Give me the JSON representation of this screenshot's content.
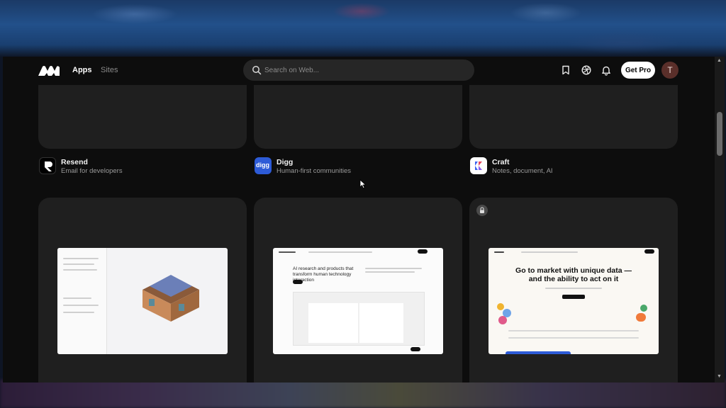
{
  "nav": {
    "tabs": [
      {
        "label": "Apps",
        "active": true
      },
      {
        "label": "Sites",
        "active": false
      }
    ]
  },
  "search": {
    "placeholder": "Search on Web..."
  },
  "header": {
    "get_pro_label": "Get Pro",
    "avatar_initial": "T",
    "icons": [
      "bookmark-icon",
      "globe-icon",
      "bell-icon"
    ]
  },
  "apps": [
    {
      "name": "Resend",
      "description": "Email for developers",
      "icon": "resend-logo-icon"
    },
    {
      "name": "Digg",
      "description": "Human-first communities",
      "icon": "digg-logo-icon",
      "icon_label": "digg"
    },
    {
      "name": "Craft",
      "description": "Notes, document, AI",
      "icon": "craft-logo-icon"
    }
  ],
  "previews": {
    "hume": {
      "headline": "AI research and products that transform human technology interaction"
    },
    "clay": {
      "headline": "Go to market with unique data — and the ability to act on it"
    }
  },
  "colors": {
    "background": "#0d0d0d",
    "card": "#1f1f1f",
    "digg_blue": "#2d5bd7",
    "accent_white": "#ffffff"
  }
}
